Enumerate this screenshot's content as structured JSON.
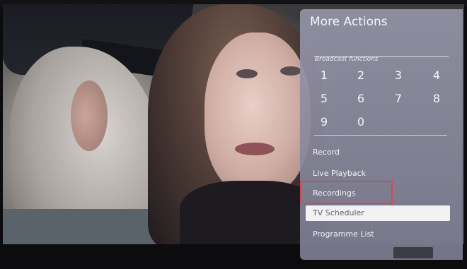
{
  "panel": {
    "title": "More Actions",
    "section_label": "Broadcast functions",
    "numpad": [
      "1",
      "2",
      "3",
      "4",
      "5",
      "6",
      "7",
      "8",
      "9",
      "0"
    ],
    "menu": [
      {
        "label": "Record"
      },
      {
        "label": "Live Playback"
      },
      {
        "label": "Recordings"
      },
      {
        "label": "TV Scheduler"
      },
      {
        "label": "Programme List"
      }
    ],
    "selected_index": 3,
    "highlighted_index": 2
  },
  "colors": {
    "panel_bg": "#8f8ea4",
    "highlight_border": "#d44a52",
    "selected_bg": "#f2f2f5"
  }
}
